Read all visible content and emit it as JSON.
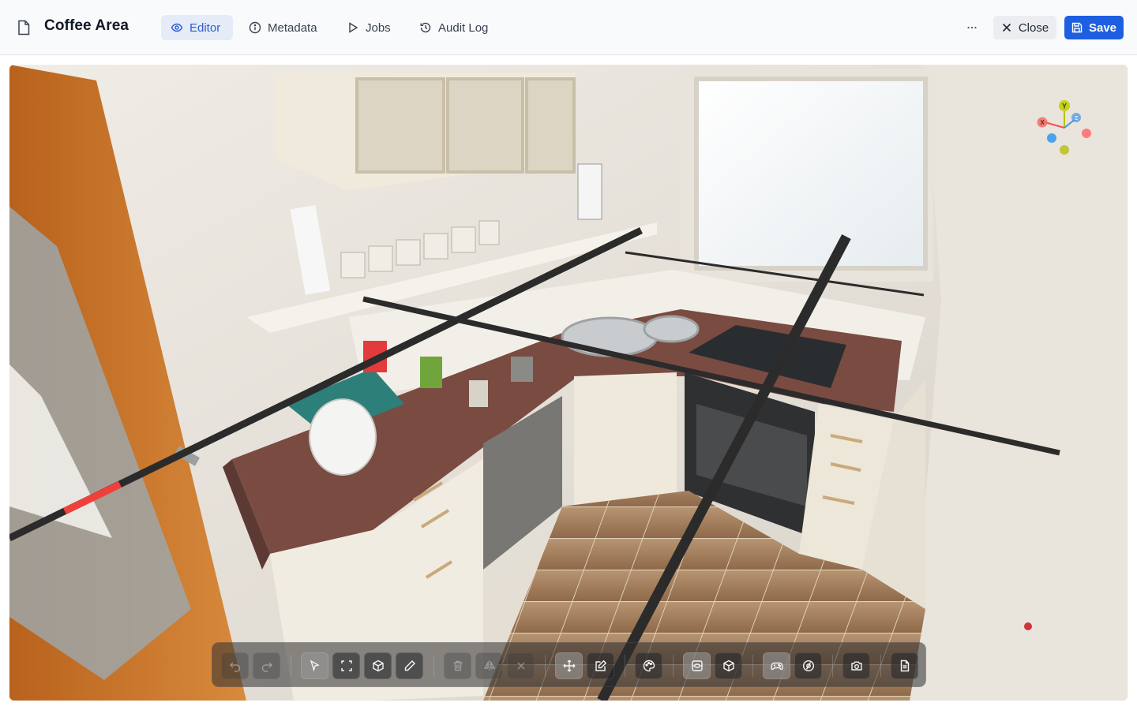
{
  "header": {
    "title": "Coffee Area",
    "tabs": [
      {
        "label": "Editor",
        "icon": "eye-icon",
        "active": true
      },
      {
        "label": "Metadata",
        "icon": "info-icon",
        "active": false
      },
      {
        "label": "Jobs",
        "icon": "play-icon",
        "active": false
      },
      {
        "label": "Audit Log",
        "icon": "history-icon",
        "active": false
      }
    ],
    "more_label": "···",
    "close_label": "Close",
    "save_label": "Save"
  },
  "viewport": {
    "gizmo": {
      "y_label": "Y",
      "x_label": "X",
      "z_label": "Z"
    }
  },
  "toolbar": {
    "tools": [
      {
        "name": "undo",
        "icon": "undo-icon",
        "state": "disabled"
      },
      {
        "name": "redo",
        "icon": "redo-icon",
        "state": "disabled"
      },
      {
        "name": "select",
        "icon": "cursor-icon",
        "state": "active"
      },
      {
        "name": "frame-selection",
        "icon": "frame-icon",
        "state": "normal"
      },
      {
        "name": "add-box",
        "icon": "box-icon",
        "state": "normal"
      },
      {
        "name": "draw",
        "icon": "pencil-icon",
        "state": "normal"
      },
      {
        "name": "delete",
        "icon": "trash-icon",
        "state": "disabled"
      },
      {
        "name": "mirror",
        "icon": "flip-icon",
        "state": "disabled"
      },
      {
        "name": "clear",
        "icon": "x-icon",
        "state": "disabled"
      },
      {
        "name": "move",
        "icon": "move-icon",
        "state": "active"
      },
      {
        "name": "edit",
        "icon": "edit-square-icon",
        "state": "normal"
      },
      {
        "name": "appearance",
        "icon": "palette-icon",
        "state": "normal"
      },
      {
        "name": "splat-view",
        "icon": "scan-icon",
        "state": "active"
      },
      {
        "name": "mesh-view",
        "icon": "cube-icon",
        "state": "normal"
      },
      {
        "name": "game-mode",
        "icon": "gamepad-icon",
        "state": "active"
      },
      {
        "name": "orbit",
        "icon": "orbit-icon",
        "state": "normal"
      },
      {
        "name": "screenshot",
        "icon": "camera-icon",
        "state": "normal"
      },
      {
        "name": "report",
        "icon": "document-icon",
        "state": "normal"
      }
    ]
  }
}
